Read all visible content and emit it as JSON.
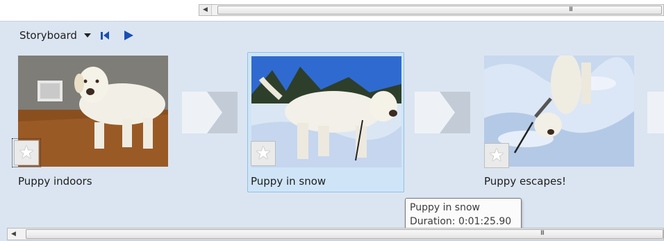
{
  "toolbar": {
    "view_label": "Storyboard",
    "view_dropdown_icon": "chevron-down-icon",
    "rewind_icon": "skip-to-start-icon",
    "play_icon": "play-icon"
  },
  "scrollbars": {
    "top_grip": "III",
    "bottom_grip": "III",
    "left_arrow": "◀"
  },
  "clips": [
    {
      "label": "Puppy indoors",
      "rating_icon": "star-icon",
      "star_glyph": "★"
    },
    {
      "label": "Puppy in snow",
      "rating_icon": "star-icon",
      "star_glyph": "★",
      "selected": true
    },
    {
      "label": "Puppy escapes!",
      "rating_icon": "star-icon",
      "star_glyph": "★"
    }
  ],
  "tooltip": {
    "title": "Puppy in snow",
    "duration_label": "Duration:",
    "duration_value": "0:01:25.90"
  },
  "colors": {
    "panel_bg": "#dbe5f1",
    "selection_bg": "#cfe5f7",
    "accent_blue": "#1a4fb4"
  }
}
